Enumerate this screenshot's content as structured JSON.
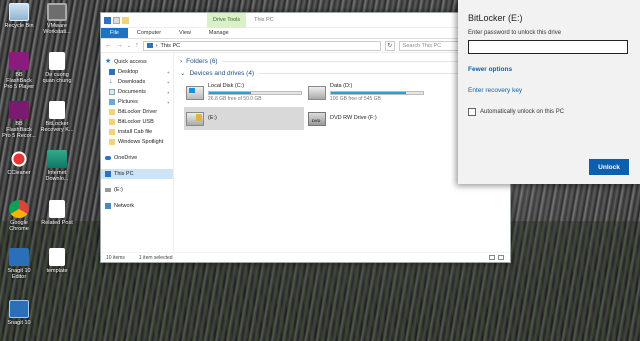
{
  "desktop": {
    "icons": [
      {
        "label": "Recycle Bin",
        "icon": "recycle-bin-icon"
      },
      {
        "label": "VMware Workstati...",
        "icon": "vmware-icon"
      },
      {
        "label": "BB FlashBack Pro 5 Player",
        "icon": "flashback-player-icon"
      },
      {
        "label": "De cuong quan chung",
        "icon": "document-icon"
      },
      {
        "label": "BB FlashBack Pro 5 Recor...",
        "icon": "flashback-recorder-icon"
      },
      {
        "label": "BitLocker Recovery K...",
        "icon": "text-file-icon"
      },
      {
        "label": "CCleaner",
        "icon": "ccleaner-icon"
      },
      {
        "label": "Internet Downlo...",
        "icon": "idm-icon"
      },
      {
        "label": "Google Chrome",
        "icon": "chrome-icon"
      },
      {
        "label": "Related Post",
        "icon": "document-icon"
      },
      {
        "label": "Snagit 10 Editor",
        "icon": "snagit-editor-icon"
      },
      {
        "label": "template",
        "icon": "text-file-icon"
      },
      {
        "label": "Snagit 10",
        "icon": "snagit-icon"
      }
    ]
  },
  "explorer": {
    "title": "This PC",
    "drive_tools_label": "Drive Tools",
    "ribbon_tabs": [
      "File",
      "Computer",
      "View",
      "Manage"
    ],
    "address": {
      "separator": "›",
      "location": "This PC"
    },
    "search_placeholder": "Search This PC",
    "nav_pane": {
      "items": [
        {
          "label": "Quick access",
          "type": "header",
          "icon": "star-icon"
        },
        {
          "label": "Desktop",
          "type": "sub",
          "icon": "desktop-icon",
          "pinned": true
        },
        {
          "label": "Downloads",
          "type": "sub",
          "icon": "download-icon",
          "pinned": true
        },
        {
          "label": "Documents",
          "type": "sub",
          "icon": "documents-icon",
          "pinned": true
        },
        {
          "label": "Pictures",
          "type": "sub",
          "icon": "pictures-icon",
          "pinned": true
        },
        {
          "label": "BitLocker Driver",
          "type": "sub",
          "icon": "folder-icon"
        },
        {
          "label": "BitLocker USB",
          "type": "sub",
          "icon": "folder-icon"
        },
        {
          "label": "install Cab file",
          "type": "sub",
          "icon": "folder-icon"
        },
        {
          "label": "Windows Spotlight",
          "type": "sub",
          "icon": "folder-icon"
        },
        {
          "label": "OneDrive",
          "type": "header",
          "icon": "onedrive-icon"
        },
        {
          "label": "This PC",
          "type": "header",
          "icon": "computer-icon",
          "selected": true
        },
        {
          "label": "(E:)",
          "type": "header",
          "icon": "drive-icon"
        },
        {
          "label": "Network",
          "type": "header",
          "icon": "network-icon"
        }
      ]
    },
    "groups": {
      "folders_label": "Folders (6)",
      "devices_label": "Devices and drives (4)"
    },
    "drives": [
      {
        "name": "Local Disk (C:)",
        "free": "26.8 GB free of 50.0 GB",
        "used_fraction": 0.46,
        "icon": "windows-drive-icon",
        "selected": false
      },
      {
        "name": "Data (D:)",
        "free": "100 GB free of 545 GB",
        "used_fraction": 0.82,
        "icon": "hard-drive-icon",
        "selected": false
      },
      {
        "name": "(E:)",
        "free": "",
        "used_fraction": null,
        "icon": "locked-drive-icon",
        "selected": true
      },
      {
        "name": "DVD RW Drive (F:)",
        "free": "",
        "used_fraction": null,
        "icon": "dvd-drive-icon",
        "selected": false
      }
    ],
    "status": {
      "item_count": "10 items",
      "selection": "1 item selected"
    }
  },
  "bitlocker": {
    "title": "BitLocker (E:)",
    "prompt": "Enter password to unlock this drive",
    "password_value": "",
    "fewer_options": "Fewer options",
    "recovery_key": "Enter recovery key",
    "auto_unlock_label": "Automatically unlock on this PC",
    "auto_unlock_checked": false,
    "unlock_label": "Unlock"
  },
  "colors": {
    "accent": "#0b5fb0",
    "drive_bar": "#26a0da",
    "drive_tools_bg": "#d9f0c9",
    "file_tab": "#1a73c5"
  }
}
